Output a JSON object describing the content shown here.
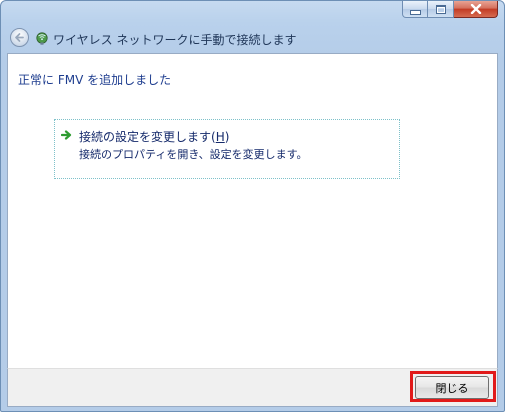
{
  "window": {
    "title": "ワイヤレス ネットワークに手動で接続します",
    "icons": {
      "back": "back-arrow-icon",
      "network": "wireless-network-icon"
    }
  },
  "content": {
    "heading": "正常に FMV を追加しました",
    "command_link": {
      "title_prefix": "接続の設定を変更します(",
      "accelerator": "H",
      "title_suffix": ")",
      "description": "接続のプロパティを開き、設定を変更します。",
      "icon": "green-arrow-icon"
    }
  },
  "footer": {
    "close_label": "閉じる"
  },
  "colors": {
    "heading": "#1e3d8f",
    "highlight": "#e11a1a",
    "link_border": "#7ec1c9"
  }
}
